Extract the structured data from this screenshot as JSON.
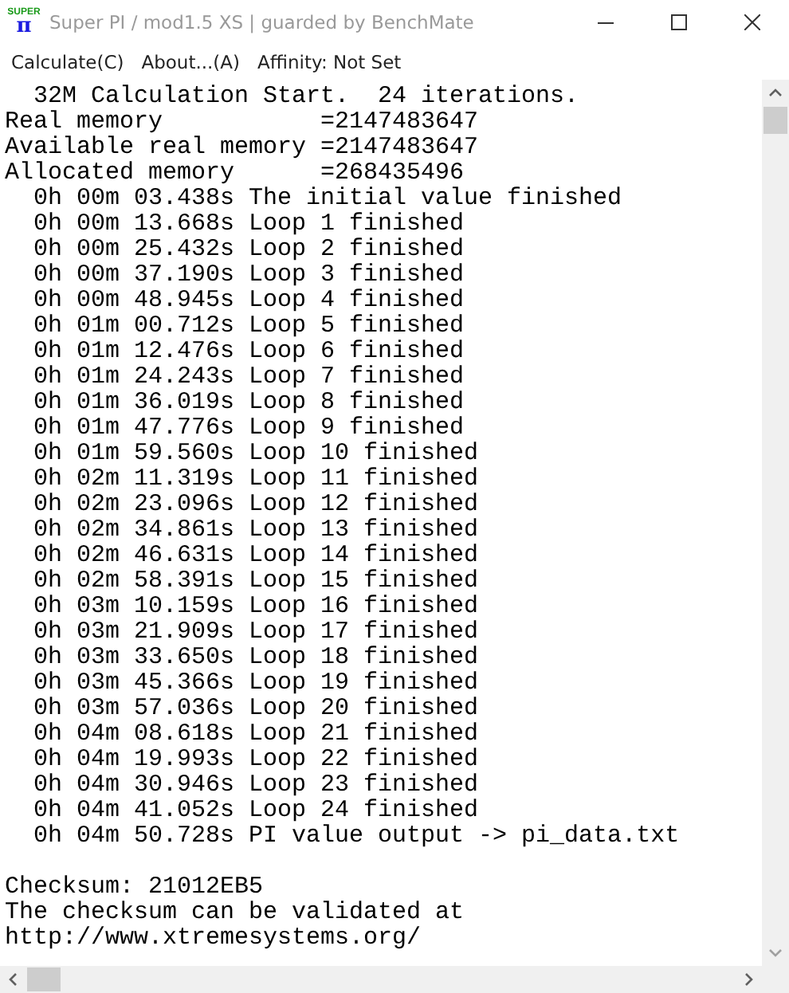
{
  "window": {
    "title": "Super PI / mod1.5 XS | guarded by BenchMate",
    "logo_text": "SUPER",
    "logo_symbol": "π"
  },
  "menu": [
    "Calculate(C)",
    "About...(A)",
    "Affinity: Not Set"
  ],
  "log_lines": [
    "  32M Calculation Start.  24 iterations.",
    "Real memory           =2147483647",
    "Available real memory =2147483647",
    "Allocated memory      =268435496",
    "  0h 00m 03.438s The initial value finished",
    "  0h 00m 13.668s Loop 1 finished",
    "  0h 00m 25.432s Loop 2 finished",
    "  0h 00m 37.190s Loop 3 finished",
    "  0h 00m 48.945s Loop 4 finished",
    "  0h 01m 00.712s Loop 5 finished",
    "  0h 01m 12.476s Loop 6 finished",
    "  0h 01m 24.243s Loop 7 finished",
    "  0h 01m 36.019s Loop 8 finished",
    "  0h 01m 47.776s Loop 9 finished",
    "  0h 01m 59.560s Loop 10 finished",
    "  0h 02m 11.319s Loop 11 finished",
    "  0h 02m 23.096s Loop 12 finished",
    "  0h 02m 34.861s Loop 13 finished",
    "  0h 02m 46.631s Loop 14 finished",
    "  0h 02m 58.391s Loop 15 finished",
    "  0h 03m 10.159s Loop 16 finished",
    "  0h 03m 21.909s Loop 17 finished",
    "  0h 03m 33.650s Loop 18 finished",
    "  0h 03m 45.366s Loop 19 finished",
    "  0h 03m 57.036s Loop 20 finished",
    "  0h 04m 08.618s Loop 21 finished",
    "  0h 04m 19.993s Loop 22 finished",
    "  0h 04m 30.946s Loop 23 finished",
    "  0h 04m 41.052s Loop 24 finished",
    "  0h 04m 50.728s PI value output -> pi_data.txt"
  ],
  "checksum_lines": [
    "Checksum: 21012EB5",
    "The checksum can be validated at",
    "http://www.xtremesystems.org/"
  ]
}
